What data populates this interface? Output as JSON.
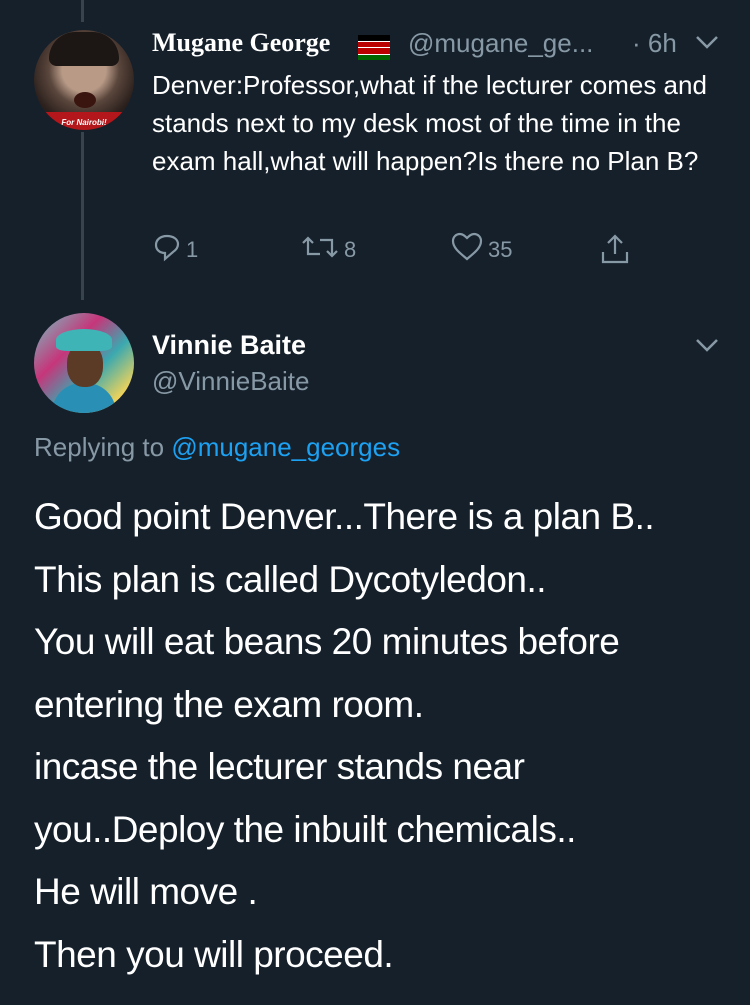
{
  "tweet1": {
    "author_name": "Mugane George",
    "handle": "@mugane_ge...",
    "time": "· 6h",
    "text": "Denver:Professor,what if the lecturer comes and stands next to my desk most of the time in the exam hall,what will happen?Is there no Plan B?",
    "avatar_caption": "For Nairobi!",
    "reply_count": "1",
    "retweet_count": "8",
    "like_count": "35"
  },
  "tweet2": {
    "author_name": "Vinnie Baite",
    "handle": "@VinnieBaite",
    "replying_prefix": "Replying to",
    "replying_to": "@mugane_georges",
    "lines": [
      "Good point Denver...There is a plan B..",
      "This plan is called Dycotyledon..",
      "You will eat beans 20 minutes before",
      "entering the exam room.",
      "incase the lecturer stands near",
      "you..Deploy the inbuilt chemicals..",
      "He will move .",
      "Then you will proceed."
    ]
  },
  "colors": {
    "background": "#15202b",
    "secondary_text": "#8899a6",
    "link": "#1da1f2",
    "thread_line": "#38444d"
  },
  "icons": [
    "reply-icon",
    "retweet-icon",
    "like-icon",
    "share-icon",
    "chevron-down-icon",
    "kenya-flag-icon"
  ]
}
